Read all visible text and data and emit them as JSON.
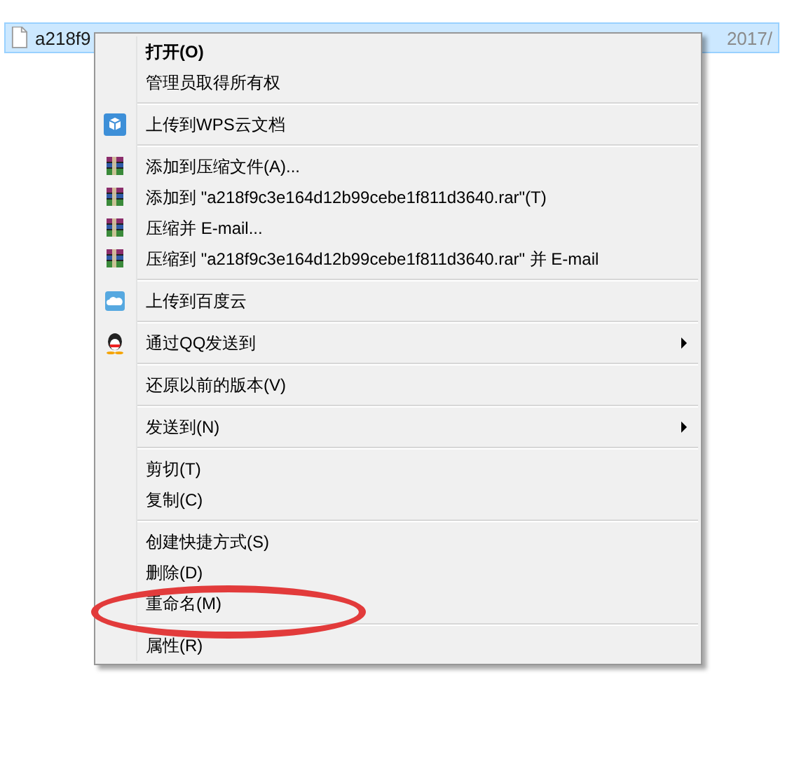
{
  "file_row": {
    "name": "a218f9",
    "date": "2017/",
    "selected": true
  },
  "context_menu": {
    "groups": [
      [
        {
          "label": "打开(O)",
          "default": true,
          "submenu": false,
          "circled": false
        },
        {
          "label": "管理员取得所有权",
          "default": false,
          "submenu": false,
          "circled": false
        }
      ],
      [
        {
          "label": "上传到WPS云文档",
          "kind": "wps",
          "default": false,
          "submenu": false,
          "circled": false
        }
      ],
      [
        {
          "label": "添加到压缩文件(A)...",
          "kind": "archive",
          "default": false,
          "submenu": false,
          "circled": false
        },
        {
          "label": "添加到 \"a218f9c3e164d12b99cebe1f811d3640.rar\"(T)",
          "kind": "archive",
          "default": false,
          "submenu": false,
          "circled": false
        },
        {
          "label": "压缩并 E-mail...",
          "kind": "archive",
          "default": false,
          "submenu": false,
          "circled": false
        },
        {
          "label": "压缩到 \"a218f9c3e164d12b99cebe1f811d3640.rar\" 并 E-mail",
          "kind": "archive",
          "default": false,
          "submenu": false,
          "circled": false
        }
      ],
      [
        {
          "label": "上传到百度云",
          "kind": "cloud",
          "default": false,
          "submenu": false,
          "circled": false
        }
      ],
      [
        {
          "label": "通过QQ发送到",
          "kind": "penguin",
          "default": false,
          "submenu": true,
          "circled": false
        }
      ],
      [
        {
          "label": "还原以前的版本(V)",
          "default": false,
          "submenu": false,
          "circled": false
        }
      ],
      [
        {
          "label": "发送到(N)",
          "default": false,
          "submenu": true,
          "circled": false
        }
      ],
      [
        {
          "label": "剪切(T)",
          "default": false,
          "submenu": false,
          "circled": false
        },
        {
          "label": "复制(C)",
          "default": false,
          "submenu": false,
          "circled": false
        }
      ],
      [
        {
          "label": "创建快捷方式(S)",
          "default": false,
          "submenu": false,
          "circled": false
        },
        {
          "label": "删除(D)",
          "default": false,
          "submenu": false,
          "circled": false
        },
        {
          "label": "重命名(M)",
          "default": false,
          "submenu": false,
          "circled": true
        }
      ],
      [
        {
          "label": "属性(R)",
          "default": false,
          "submenu": false,
          "circled": false
        }
      ]
    ]
  }
}
